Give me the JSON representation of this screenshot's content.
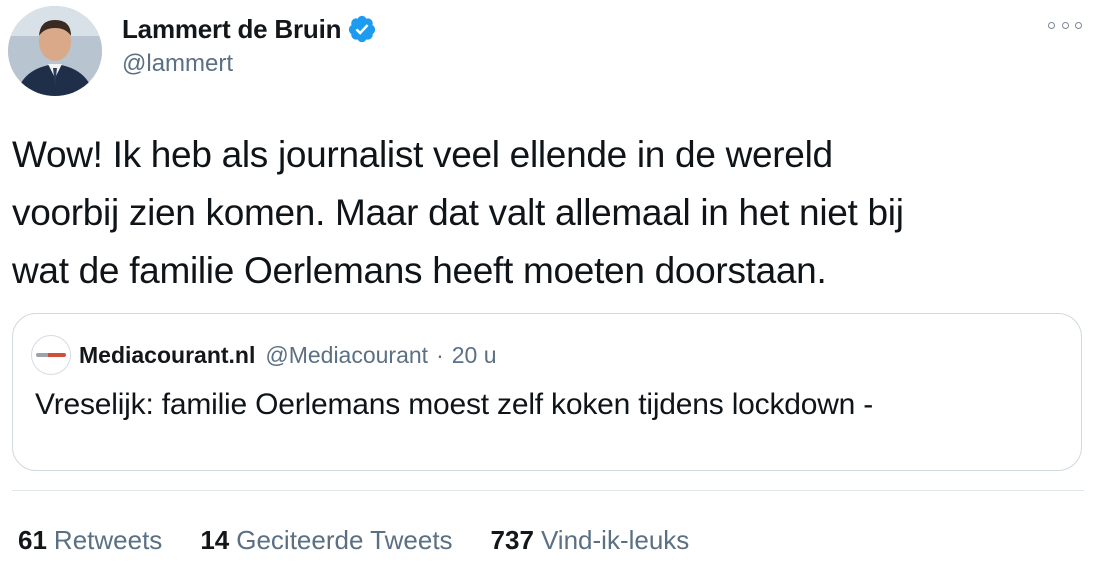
{
  "author": {
    "display_name": "Lammert de Bruin",
    "handle": "@lammert",
    "verified": true,
    "avatar_icon": "profile-photo"
  },
  "tweet": {
    "text": "Wow! Ik heb als journalist veel ellende in de wereld\nvoorbij zien komen. Maar dat valt allemaal in het niet bij\nwat de familie Oerlemans heeft moeten doorstaan."
  },
  "quote": {
    "name": "Mediacourant.nl",
    "handle": "@Mediacourant",
    "separator": "·",
    "time": "20 u",
    "text": "Vreselijk: familie Oerlemans moest zelf koken tijdens lockdown -"
  },
  "stats": {
    "retweets": {
      "count": "61",
      "label": "Retweets"
    },
    "quotes": {
      "count": "14",
      "label": "Geciteerde Tweets"
    },
    "likes": {
      "count": "737",
      "label": "Vind-ik-leuks"
    }
  },
  "colors": {
    "verified_badge": "#1d9bf0",
    "secondary_text": "#5b7083",
    "border": "#cfd9de"
  }
}
